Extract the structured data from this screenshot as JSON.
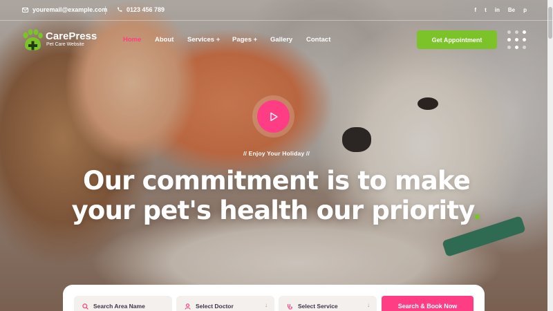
{
  "topbar": {
    "email": "youremail@example.com",
    "phone": "0123 456 789",
    "socials": [
      "f",
      "t",
      "in",
      "Be",
      "p"
    ]
  },
  "logo": {
    "title": "CarePress",
    "subtitle": "Pet Care Website"
  },
  "nav": {
    "items": [
      {
        "label": "Home",
        "active": true
      },
      {
        "label": "About"
      },
      {
        "label": "Services +"
      },
      {
        "label": "Pages +"
      },
      {
        "label": "Gallery"
      },
      {
        "label": "Contact"
      }
    ],
    "cta_label": "Get Appointment"
  },
  "hero": {
    "tagline": "//   Enjoy Your Holiday   //",
    "headline_line1": "Our commitment is to make",
    "headline_line2": "your pet's health our priority",
    "headline_end": "."
  },
  "booking": {
    "area_placeholder": "Search Area Name",
    "doctor_placeholder": "Select Doctor",
    "service_placeholder": "Select Service",
    "submit_label": "Search & Book Now"
  },
  "colors": {
    "accent_pink": "#ff3d84",
    "accent_green": "#7cc229"
  }
}
